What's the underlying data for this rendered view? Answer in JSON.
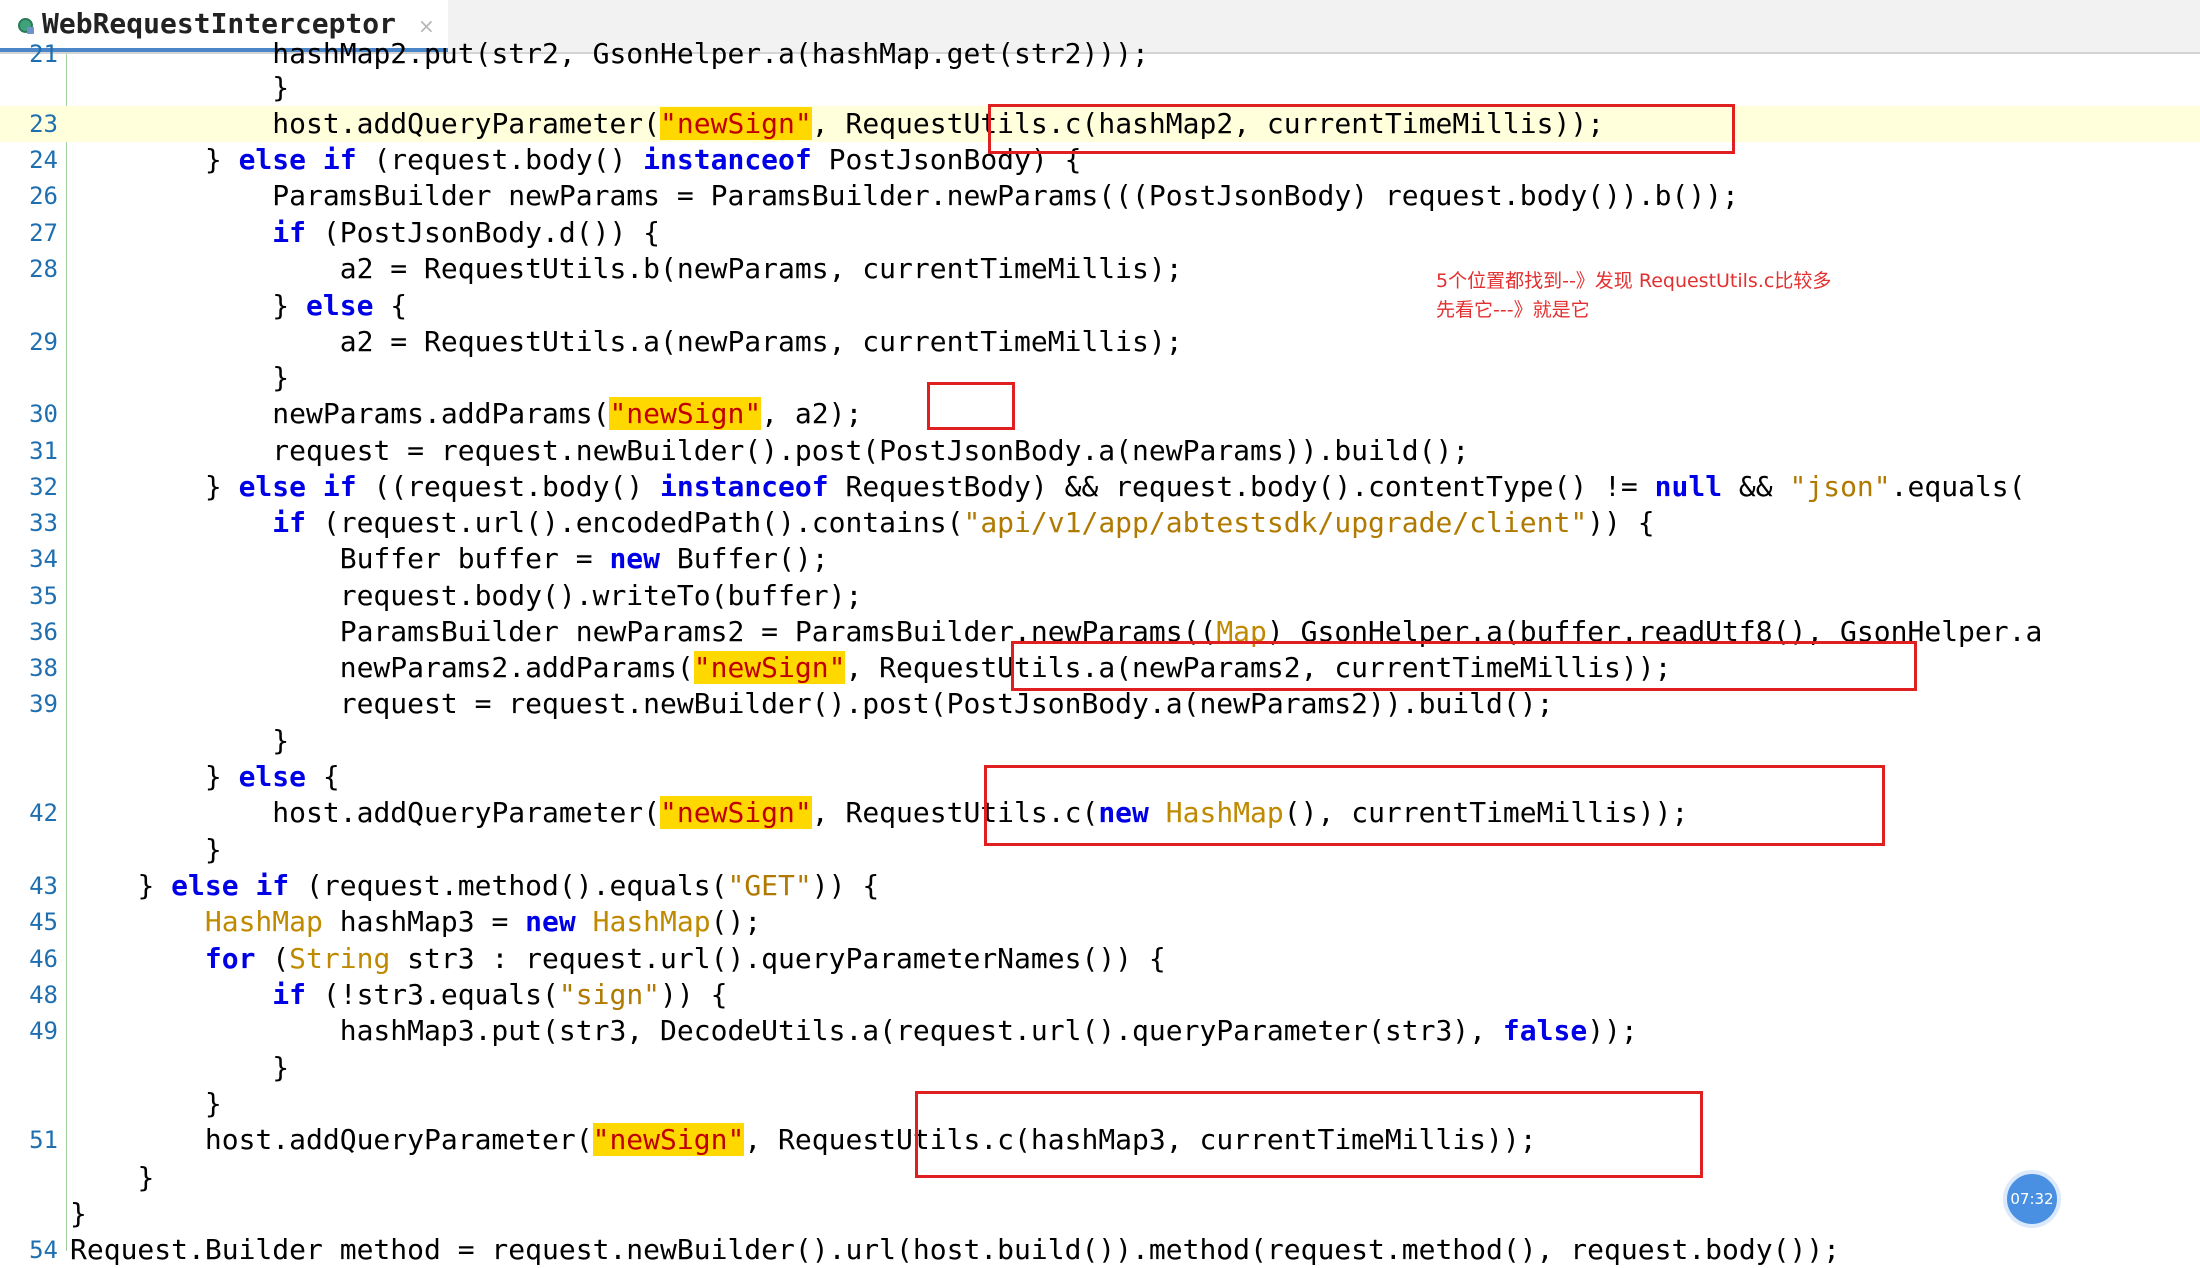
{
  "tab": {
    "title": "WebRequestInterceptor",
    "close": "×"
  },
  "annotation": {
    "line1": "5个位置都找到--》发现 RequestUtils.c比较多",
    "line2": "先看它---》就是它"
  },
  "clock": {
    "time": "07:32"
  },
  "gutter": {
    "line_numbers": [
      "21",
      "23",
      "24",
      "26",
      "27",
      "28",
      "",
      "29",
      "",
      "30",
      "31",
      "32",
      "33",
      "34",
      "35",
      "36",
      "38",
      "39",
      "",
      "",
      "42",
      "",
      "43",
      "45",
      "46",
      "48",
      "49",
      "",
      "",
      "51",
      "",
      "",
      "54"
    ]
  },
  "code": {
    "l21": {
      "ind": "            ",
      "t1": "hashMap2.put(str2, GsonHelper.a(hashMap.get(str2)));"
    },
    "l22": {
      "ind": "            ",
      "t1": "}"
    },
    "l23": {
      "ind": "            ",
      "t1": "host.addQueryParameter(",
      "s1": "\"newSign\"",
      "t2": ", ",
      "t3": "RequestUtils.c(hashMap2, currentTimeMillis));"
    },
    "l24": {
      "ind": "        ",
      "t1": "} ",
      "k1": "else if",
      "t2": " (request.body() ",
      "k2": "instanceof",
      "t3": " PostJsonBody) {"
    },
    "l26": {
      "ind": "            ",
      "t1": "ParamsBuilder newParams = ParamsBuilder.newParams(((PostJsonBody) request.body()).b());"
    },
    "l27": {
      "ind": "            ",
      "k1": "if",
      "t1": " (PostJsonBody.d()) {"
    },
    "l28": {
      "ind": "                ",
      "t1": "a2 = RequestUtils.b(newParams, currentTimeMillis);"
    },
    "l28b": {
      "ind": "            ",
      "t1": "} ",
      "k1": "else",
      "t2": " {"
    },
    "l29": {
      "ind": "                ",
      "t1": "a2 = RequestUtils.a(newParams, currentTimeMillis);"
    },
    "l29b": {
      "ind": "            ",
      "t1": "}"
    },
    "l30": {
      "ind": "            ",
      "t1": "newParams.addParams(",
      "s1": "\"newSign\"",
      "t2": ", a2);"
    },
    "l31": {
      "ind": "            ",
      "t1": "request = request.newBuilder().post(PostJsonBody.a(newParams)).build();"
    },
    "l32": {
      "ind": "        ",
      "t1": "} ",
      "k1": "else if",
      "t2": " ((request.body() ",
      "k2": "instanceof",
      "t3": " RequestBody) && request.body().contentType() != ",
      "k3": "null",
      "t4": " && ",
      "s1": "\"json\"",
      "t5": ".equals("
    },
    "l33": {
      "ind": "            ",
      "k1": "if",
      "t1": " (request.url().encodedPath().contains(",
      "s1": "\"api/v1/app/abtestsdk/upgrade/client\"",
      "t2": ")) {"
    },
    "l34": {
      "ind": "                ",
      "t1": "Buffer buffer = ",
      "k1": "new",
      "t2": " Buffer();"
    },
    "l35": {
      "ind": "                ",
      "t1": "request.body().writeTo(buffer);"
    },
    "l36": {
      "ind": "                ",
      "t1": "ParamsBuilder newParams2 = ParamsBuilder.newParams((",
      "c1": "Map",
      "t2": ") GsonHelper.a(buffer.readUtf8(), GsonHelper.a"
    },
    "l38": {
      "ind": "                ",
      "t1": "newParams2.addParams(",
      "s1": "\"newSign\"",
      "t2": ", RequestUtils.a(newParams2, currentTimeMillis));"
    },
    "l39": {
      "ind": "                ",
      "t1": "request = request.newBuilder().post(PostJsonBody.a(newParams2)).build();"
    },
    "l39b": {
      "ind": "            ",
      "t1": "}"
    },
    "l41": {
      "ind": "        ",
      "t1": "} ",
      "k1": "else",
      "t2": " {"
    },
    "l42": {
      "ind": "            ",
      "t1": "host.addQueryParameter(",
      "s1": "\"newSign\"",
      "t2": ", RequestUtils.c(",
      "k1": "new",
      "t3": " ",
      "c1": "HashMap",
      "t4": "(), currentTimeMillis));"
    },
    "l42b": {
      "ind": "        ",
      "t1": "}"
    },
    "l43": {
      "ind": "    ",
      "t1": "} ",
      "k1": "else if",
      "t2": " (request.method().equals(",
      "s1": "\"GET\"",
      "t3": ")) {"
    },
    "l45": {
      "ind": "        ",
      "c1": "HashMap",
      "t1": " hashMap3 = ",
      "k1": "new",
      "t2": " ",
      "c2": "HashMap",
      "t3": "();"
    },
    "l46": {
      "ind": "        ",
      "k1": "for",
      "t1": " (",
      "c1": "String",
      "t2": " str3 : request.url().queryParameterNames()) {"
    },
    "l48": {
      "ind": "            ",
      "k1": "if",
      "t1": " (!str3.equals(",
      "s1": "\"sign\"",
      "t2": ")) {"
    },
    "l49": {
      "ind": "                ",
      "t1": "hashMap3.put(str3, DecodeUtils.a(request.url().queryParameter(str3), ",
      "k1": "false",
      "t2": "));"
    },
    "l49b": {
      "ind": "            ",
      "t1": "}"
    },
    "l50": {
      "ind": "        ",
      "t1": "}"
    },
    "l51": {
      "ind": "        ",
      "t1": "host.addQueryParameter(",
      "s1": "\"newSign\"",
      "t2": ", RequestUtils.c(hashMap3, currentTimeMillis));"
    },
    "l52": {
      "ind": "    ",
      "t1": "}"
    },
    "l53": {
      "ind": "",
      "t1": "}"
    },
    "l54": {
      "ind": "",
      "t1": "Request.Builder method = request.newBuilder().url(host.build()).method(request.method(), request.body());"
    }
  }
}
